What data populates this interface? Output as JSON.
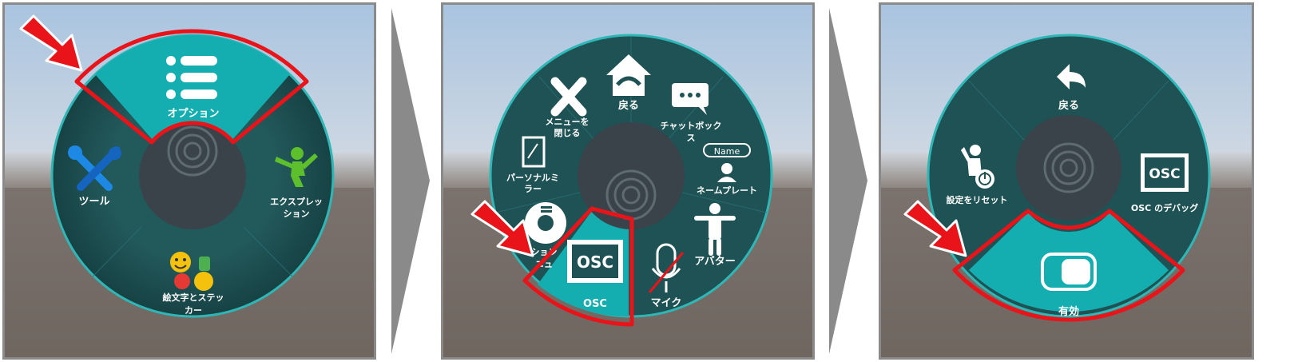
{
  "panel1": {
    "items": {
      "options": "オプション",
      "tools": "ツール",
      "expressions_l1": "エクスプレッ",
      "expressions_l2": "ション",
      "emoji_l1": "絵文字とステッ",
      "emoji_l2": "カー"
    }
  },
  "panel2": {
    "items": {
      "back": "戻る",
      "close_l1": "メニューを",
      "close_l2": "閉じる",
      "chatbox_l1": "チャットボック",
      "chatbox_l2": "ス",
      "personal_mirror_l1": "パーソナルミ",
      "personal_mirror_l2": "ラー",
      "nameplate_badge": "Name",
      "nameplate": "ネームプレート",
      "options_l1": "ション",
      "options_l2": "ニュ",
      "osc_icon": "OSC",
      "osc": "OSC",
      "mic": "マイク",
      "avatar": "アバター"
    }
  },
  "panel3": {
    "items": {
      "back": "戻る",
      "reset": "設定をリセット",
      "osc_icon": "OSC",
      "osc_debug": "OSC のデバッグ",
      "enabled": "有効"
    }
  },
  "colors": {
    "wheel_dark": "#1b4a4c",
    "wheel_rim": "#2fb7b7",
    "highlight_teal": "#15aeb0",
    "center_gray": "#3a434a",
    "callout_red": "#e8141a",
    "chevron_gray": "#8a8a8a"
  },
  "icons": [
    "menu-list-icon",
    "tools-icon",
    "expression-figure-icon",
    "emoji-sticker-icon",
    "home-back-icon",
    "close-x-icon",
    "chat-bubble-icon",
    "mirror-icon",
    "nameplate-icon",
    "options-mini-wheel-icon",
    "osc-icon",
    "mic-muted-icon",
    "avatar-figure-icon",
    "undo-arrow-icon",
    "reset-figure-icon",
    "toggle-icon",
    "callout-arrow-icon",
    "next-step-chevron-icon"
  ]
}
